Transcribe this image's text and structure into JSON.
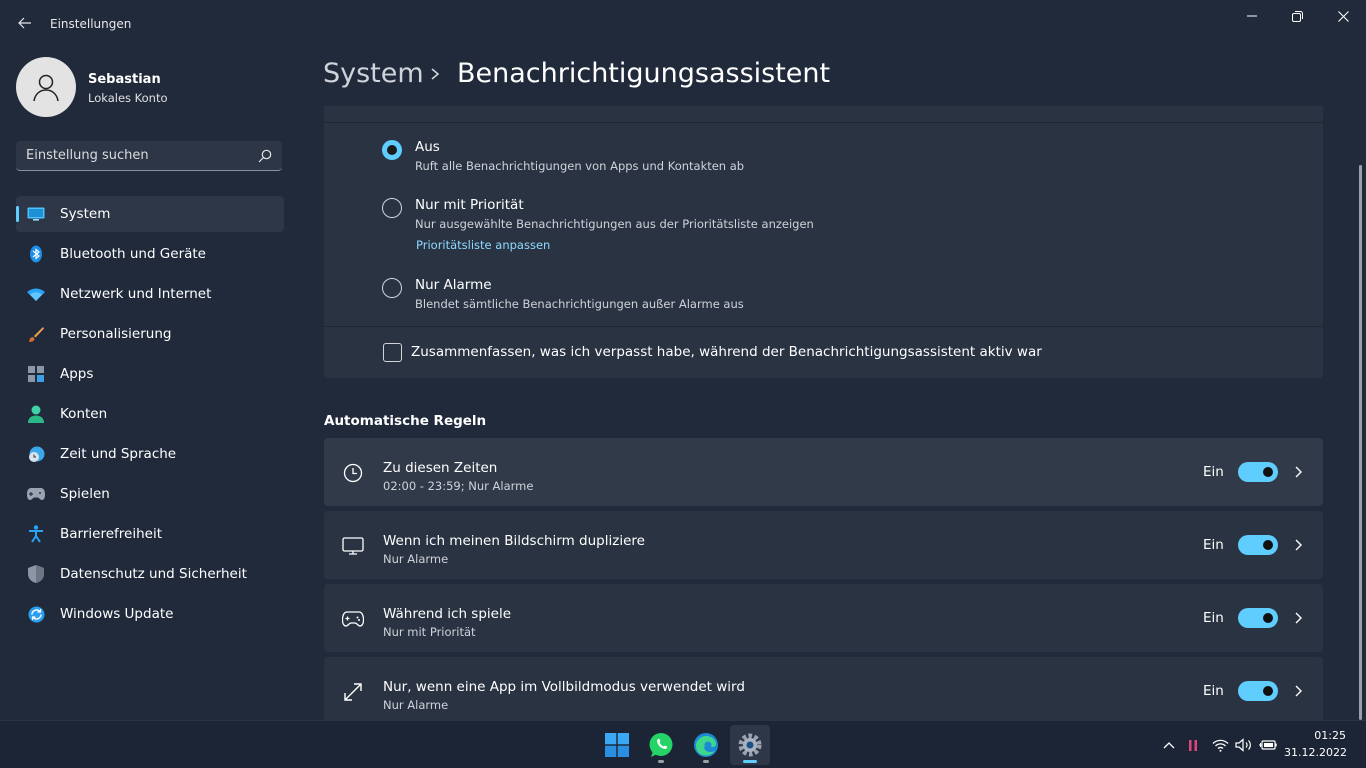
{
  "window": {
    "title": "Einstellungen"
  },
  "user": {
    "name": "Sebastian",
    "account": "Lokales Konto"
  },
  "search": {
    "placeholder": "Einstellung suchen"
  },
  "nav": {
    "items": [
      {
        "label": "System",
        "icon": "monitor-icon"
      },
      {
        "label": "Bluetooth und Geräte",
        "icon": "bluetooth-icon"
      },
      {
        "label": "Netzwerk und Internet",
        "icon": "wifi-icon"
      },
      {
        "label": "Personalisierung",
        "icon": "brush-icon"
      },
      {
        "label": "Apps",
        "icon": "apps-icon"
      },
      {
        "label": "Konten",
        "icon": "person-icon"
      },
      {
        "label": "Zeit und Sprache",
        "icon": "globe-clock-icon"
      },
      {
        "label": "Spielen",
        "icon": "gamepad-icon"
      },
      {
        "label": "Barrierefreiheit",
        "icon": "accessibility-icon"
      },
      {
        "label": "Datenschutz und Sicherheit",
        "icon": "shield-icon"
      },
      {
        "label": "Windows Update",
        "icon": "update-icon"
      }
    ]
  },
  "header": {
    "parent": "System",
    "current": "Benachrichtigungsassistent"
  },
  "focus_options": [
    {
      "title": "Aus",
      "desc": "Ruft alle Benachrichtigungen von Apps und Kontakten ab",
      "selected": true
    },
    {
      "title": "Nur mit Priorität",
      "desc": "Nur ausgewählte Benachrichtigungen aus der Prioritätsliste anzeigen",
      "link": "Prioritätsliste anpassen",
      "selected": false
    },
    {
      "title": "Nur Alarme",
      "desc": "Blendet sämtliche Benachrichtigungen außer Alarme aus",
      "selected": false
    }
  ],
  "summary_checkbox": {
    "label": "Zusammenfassen, was ich verpasst habe, während der Benachrichtigungsassistent aktiv war",
    "checked": false
  },
  "automatic_rules": {
    "title": "Automatische Regeln",
    "rules": [
      {
        "title": "Zu diesen Zeiten",
        "subtitle": "02:00 - 23:59; Nur Alarme",
        "state": "Ein",
        "on": true,
        "icon": "clock-icon"
      },
      {
        "title": "Wenn ich meinen Bildschirm dupliziere",
        "subtitle": "Nur Alarme",
        "state": "Ein",
        "on": true,
        "icon": "display-icon"
      },
      {
        "title": "Während ich spiele",
        "subtitle": "Nur mit Priorität",
        "state": "Ein",
        "on": true,
        "icon": "gamepad-icon"
      },
      {
        "title": "Nur, wenn eine App im Vollbildmodus verwendet wird",
        "subtitle": "Nur Alarme",
        "state": "Ein",
        "on": true,
        "icon": "fullscreen-icon"
      }
    ]
  },
  "taskbar": {
    "apps": [
      "windows-start-icon",
      "whatsapp-icon",
      "edge-icon",
      "settings-icon"
    ],
    "time": "01:25",
    "date": "31.12.2022"
  },
  "colors": {
    "accent": "#60cdff",
    "background": "#202a3a",
    "card": "#2a3342"
  }
}
